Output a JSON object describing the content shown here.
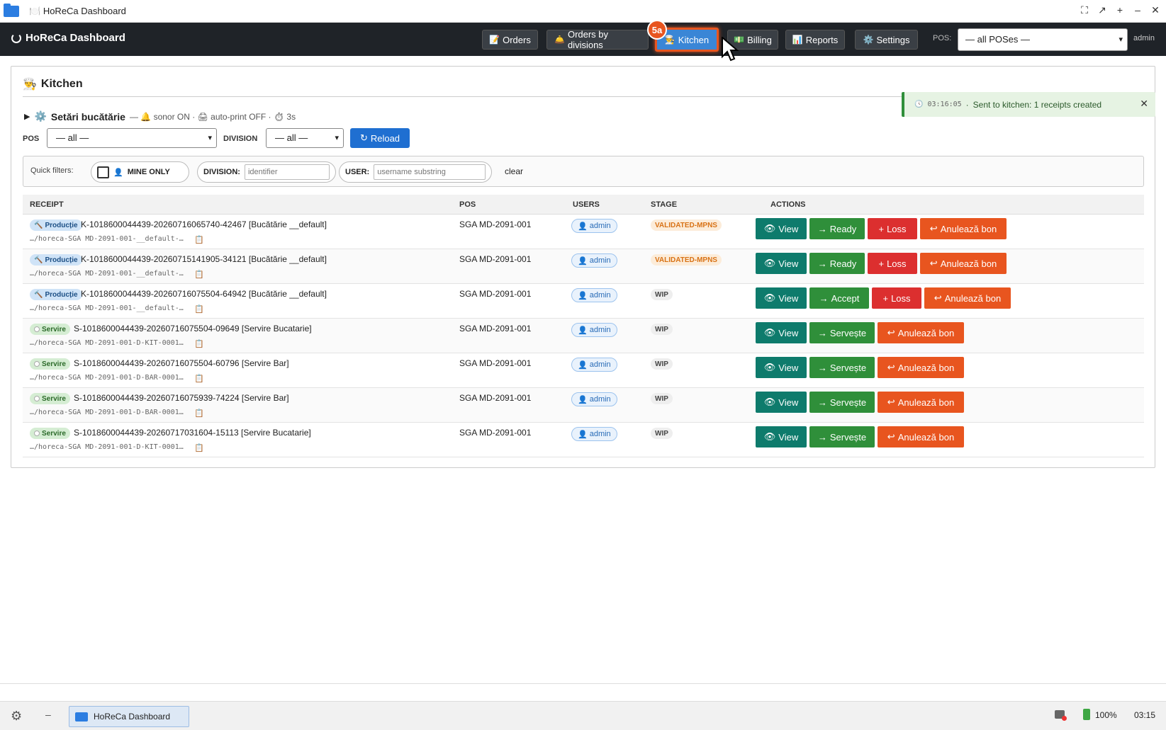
{
  "window": {
    "title": "HoReCa Dashboard",
    "title_icon": "🍽️",
    "controls": [
      "⛶",
      "↗",
      "+",
      "–",
      "✕"
    ]
  },
  "appbar": {
    "brand": "HoReCa Dashboard",
    "nav": [
      {
        "icon": "📝",
        "label": "Orders"
      },
      {
        "icon": "🛎️",
        "label": "Orders by divisions"
      },
      {
        "icon": "👨‍🍳",
        "label": "Kitchen"
      },
      {
        "icon": "💵",
        "label": "Billing"
      },
      {
        "icon": "📊",
        "label": "Reports"
      },
      {
        "icon": "⚙️",
        "label": "Settings"
      }
    ],
    "active_nav": "Kitchen",
    "pos_label": "POS:",
    "pos_value": "— all POSes —",
    "user": "admin",
    "step_badge": "5a"
  },
  "kitchen": {
    "title_icon": "👨‍🍳",
    "title": "Kitchen",
    "settings": {
      "toggle": "▶",
      "icon": "⚙️",
      "title": "Setări bucătărie",
      "meta": "— 🔔 sonor ON · 🖨 auto-print OFF · ⏱ 3s"
    },
    "filters": {
      "pos_label": "POS",
      "pos_value": "— all —",
      "division_label": "DIVISION",
      "division_value": "— all —",
      "reload_icon": "↻",
      "reload_label": "Reload"
    },
    "quick_filters": {
      "label": "Quick filters:",
      "mine_icon": "👤",
      "mine_label": "MINE ONLY",
      "mine_checked": false,
      "division_label": "DIVISION:",
      "division_placeholder": "identifier",
      "user_label": "USER:",
      "user_placeholder": "username substring",
      "clear_label": "clear"
    },
    "columns": [
      "RECEIPT",
      "POS",
      "USERS",
      "STAGE",
      "ACTIONS"
    ],
    "rows": [
      {
        "tag": "Producție",
        "title": "K-1018600044439-20260716065740-42467 [Bucătărie __default]",
        "path": "…/horeca-SGA MD-2091-001-__default-…",
        "pos": "SGA MD-2091-001",
        "user": "admin",
        "stage": "VALIDATED-MPNS",
        "actions": [
          "View",
          "Ready",
          "Loss",
          "Anulează bon"
        ]
      },
      {
        "tag": "Producție",
        "title": "K-1018600044439-20260715141905-34121 [Bucătărie __default]",
        "path": "…/horeca-SGA MD-2091-001-__default-…",
        "pos": "SGA MD-2091-001",
        "user": "admin",
        "stage": "VALIDATED-MPNS",
        "actions": [
          "View",
          "Ready",
          "Loss",
          "Anulează bon"
        ]
      },
      {
        "tag": "Producție",
        "title": "K-1018600044439-20260716075504-64942 [Bucătărie __default]",
        "path": "…/horeca-SGA MD-2091-001-__default-…",
        "pos": "SGA MD-2091-001",
        "user": "admin",
        "stage": "WIP",
        "actions": [
          "View",
          "Accept",
          "Loss",
          "Anulează bon"
        ]
      },
      {
        "tag": "Servire",
        "title": "S-1018600044439-20260716075504-09649 [Servire Bucatarie]",
        "path": "…/horeca-SGA MD-2091-001-D-KIT-0001…",
        "pos": "SGA MD-2091-001",
        "user": "admin",
        "stage": "WIP",
        "actions": [
          "View",
          "Servește",
          "Anulează bon"
        ]
      },
      {
        "tag": "Servire",
        "title": "S-1018600044439-20260716075504-60796 [Servire Bar]",
        "path": "…/horeca-SGA MD-2091-001-D-BAR-0001…",
        "pos": "SGA MD-2091-001",
        "user": "admin",
        "stage": "WIP",
        "actions": [
          "View",
          "Servește",
          "Anulează bon"
        ]
      },
      {
        "tag": "Servire",
        "title": "S-1018600044439-20260716075939-74224 [Servire Bar]",
        "path": "…/horeca-SGA MD-2091-001-D-BAR-0001…",
        "pos": "SGA MD-2091-001",
        "user": "admin",
        "stage": "WIP",
        "actions": [
          "View",
          "Servește",
          "Anulează bon"
        ]
      },
      {
        "tag": "Servire",
        "title": "S-1018600044439-20260717031604-15113 [Servire Bucatarie]",
        "path": "…/horeca-SGA MD-2091-001-D-KIT-0001…",
        "pos": "SGA MD-2091-001",
        "user": "admin",
        "stage": "WIP",
        "actions": [
          "View",
          "Servește",
          "Anulează bon"
        ]
      }
    ]
  },
  "toast": {
    "time": "03:16:05",
    "separator": "·",
    "message": "Sent to kitchen: 1 receipts created",
    "close": "✕"
  },
  "taskbar": {
    "app_label": "HoReCa Dashboard",
    "battery": "100%",
    "time": "03:15"
  },
  "colors": {
    "appbar_bg": "#1f2328",
    "active_nav": "#3a86d6",
    "highlight": "#e8551f",
    "view_btn": "#0e7b6c",
    "go_btn": "#2f8f3a",
    "loss_btn": "#dc2f2f",
    "reload_btn": "#1f6fd1"
  }
}
